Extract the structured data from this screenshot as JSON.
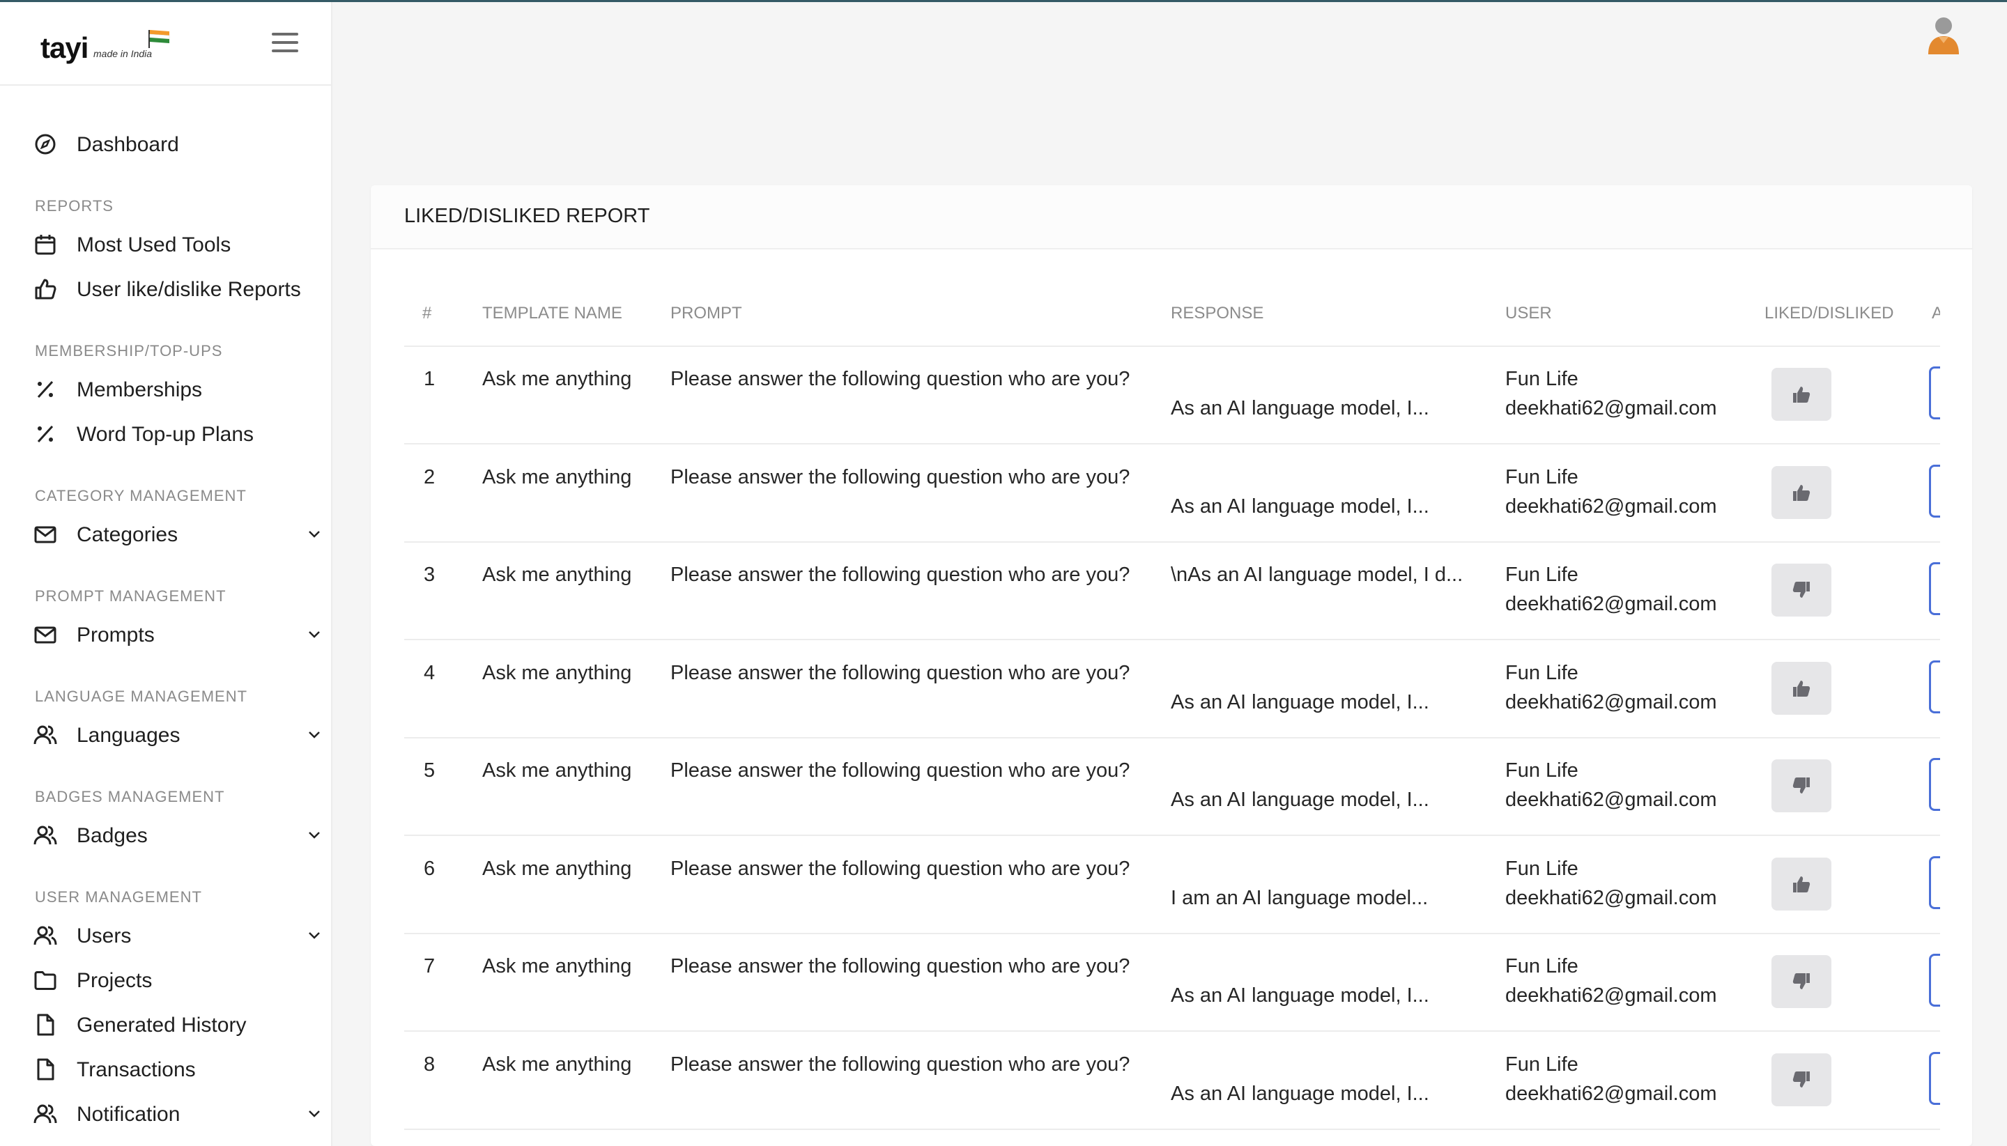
{
  "brand": {
    "name": "tayi",
    "tagline": "made in India"
  },
  "sidebar": {
    "dashboard": "Dashboard",
    "sections": [
      {
        "label": "REPORTS"
      },
      {
        "label": "MEMBERSHIP/TOP-UPS"
      },
      {
        "label": "CATEGORY MANAGEMENT"
      },
      {
        "label": "PROMPT MANAGEMENT"
      },
      {
        "label": "LANGUAGE MANAGEMENT"
      },
      {
        "label": "BADGES MANAGEMENT"
      },
      {
        "label": "USER MANAGEMENT"
      }
    ],
    "items": {
      "most_used_tools": "Most Used Tools",
      "user_reports": "User like/dislike Reports",
      "memberships": "Memberships",
      "word_topup": "Word Top-up Plans",
      "categories": "Categories",
      "prompts": "Prompts",
      "languages": "Languages",
      "badges": "Badges",
      "users": "Users",
      "projects": "Projects",
      "generated_history": "Generated History",
      "transactions": "Transactions",
      "notification": "Notification"
    }
  },
  "report": {
    "title": "LIKED/DISLIKED REPORT",
    "columns": {
      "num": "#",
      "template": "TEMPLATE NAME",
      "prompt": "PROMPT",
      "response": "RESPONSE",
      "user": "USER",
      "liked": "LIKED/DISLIKED",
      "action_fragment": "A"
    },
    "rows": [
      {
        "num": "1",
        "template": "Ask me anything",
        "prompt": "Please answer the following question who are you?",
        "response": "As an AI language model, I...",
        "user_name": "Fun Life",
        "user_email": "deekhati62@gmail.com",
        "reaction": "like"
      },
      {
        "num": "2",
        "template": "Ask me anything",
        "prompt": "Please answer the following question who are you?",
        "response": "As an AI language model, I...",
        "user_name": "Fun Life",
        "user_email": "deekhati62@gmail.com",
        "reaction": "like"
      },
      {
        "num": "3",
        "template": "Ask me anything",
        "prompt": "Please answer the following question who are you?",
        "response": "\\nAs an AI language model, I d...",
        "user_name": "Fun Life",
        "user_email": "deekhati62@gmail.com",
        "reaction": "dislike"
      },
      {
        "num": "4",
        "template": "Ask me anything",
        "prompt": "Please answer the following question who are you?",
        "response": "As an AI language model, I...",
        "user_name": "Fun Life",
        "user_email": "deekhati62@gmail.com",
        "reaction": "like"
      },
      {
        "num": "5",
        "template": "Ask me anything",
        "prompt": "Please answer the following question who are you?",
        "response": "As an AI language model, I...",
        "user_name": "Fun Life",
        "user_email": "deekhati62@gmail.com",
        "reaction": "dislike"
      },
      {
        "num": "6",
        "template": "Ask me anything",
        "prompt": "Please answer the following question who are you?",
        "response": "I am an AI language model...",
        "user_name": "Fun Life",
        "user_email": "deekhati62@gmail.com",
        "reaction": "like"
      },
      {
        "num": "7",
        "template": "Ask me anything",
        "prompt": "Please answer the following question who are you?",
        "response": "As an AI language model, I...",
        "user_name": "Fun Life",
        "user_email": "deekhati62@gmail.com",
        "reaction": "dislike"
      },
      {
        "num": "8",
        "template": "Ask me anything",
        "prompt": "Please answer the following question who are you?",
        "response": "As an AI language model, I...",
        "user_name": "Fun Life",
        "user_email": "deekhati62@gmail.com",
        "reaction": "dislike"
      }
    ]
  },
  "colors": {
    "accent": "#4a6fd8",
    "avatar": "#e3892f",
    "top_line": "#355a66"
  }
}
